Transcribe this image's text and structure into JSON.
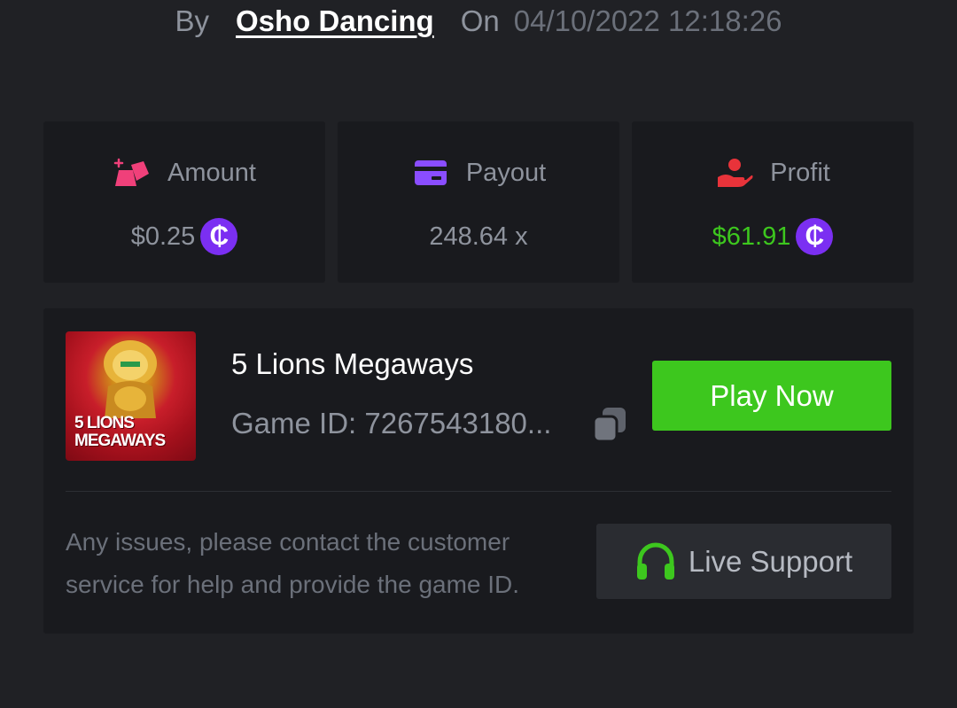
{
  "header": {
    "by_label": "By",
    "username": "Osho Dancing",
    "on_label": "On",
    "datetime": "04/10/2022 12:18:26"
  },
  "stats": {
    "amount": {
      "label": "Amount",
      "value": "$0.25",
      "icon": "amount-icon",
      "coin": "₵"
    },
    "payout": {
      "label": "Payout",
      "value": "248.64 x",
      "icon": "card-icon"
    },
    "profit": {
      "label": "Profit",
      "value": "$61.91",
      "icon": "profit-hand-icon",
      "coin": "₵"
    }
  },
  "game": {
    "title": "5 Lions Megaways",
    "id_text": "Game ID: 7267543180...",
    "thumbnail_text": [
      "5 LIONS",
      "MEGAWAYS"
    ],
    "play_label": "Play Now"
  },
  "help": {
    "text": "Any issues, please contact the customer service for help and provide the game ID.",
    "support_label": "Live Support"
  },
  "colors": {
    "background": "#202125",
    "card": "#191a1e",
    "accent_green": "#3dc71e",
    "coin_purple": "#7b2ff2",
    "amount_pink": "#f0407a",
    "payout_purple": "#8a4dff",
    "profit_red": "#e8333a"
  }
}
